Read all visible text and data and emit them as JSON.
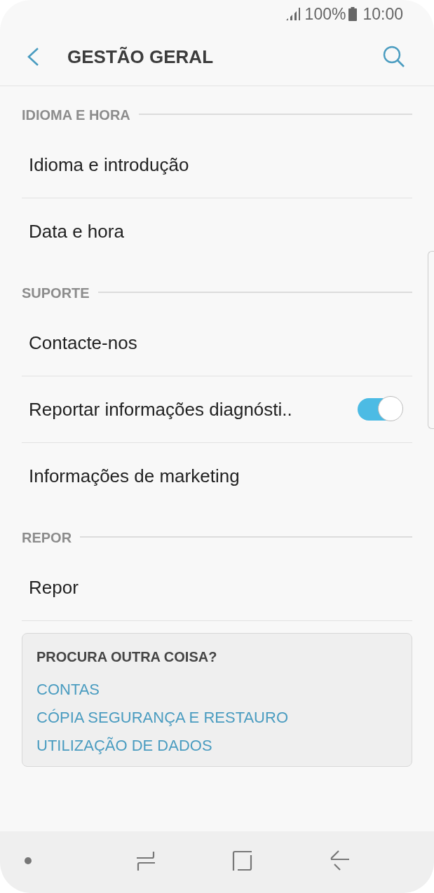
{
  "status_bar": {
    "battery": "100%",
    "time": "10:00"
  },
  "app_bar": {
    "title": "GESTÃO GERAL"
  },
  "sections": [
    {
      "header": "IDIOMA E HORA",
      "items": [
        {
          "kind": "plain",
          "label": "Idioma e introdução"
        },
        {
          "kind": "plain",
          "label": "Data e hora"
        }
      ]
    },
    {
      "header": "SUPORTE",
      "items": [
        {
          "kind": "plain",
          "label": "Contacte-nos"
        },
        {
          "kind": "toggle",
          "label": "Reportar informações diagnósti..",
          "on": true
        },
        {
          "kind": "plain",
          "label": "Informações de marketing"
        }
      ]
    },
    {
      "header": "REPOR",
      "items": [
        {
          "kind": "plain",
          "label": "Repor"
        }
      ]
    }
  ],
  "suggestions": {
    "title": "PROCURA OUTRA COISA?",
    "links": [
      "CONTAS",
      "CÓPIA SEGURANÇA E RESTAURO",
      "UTILIZAÇÃO DE DADOS"
    ]
  }
}
